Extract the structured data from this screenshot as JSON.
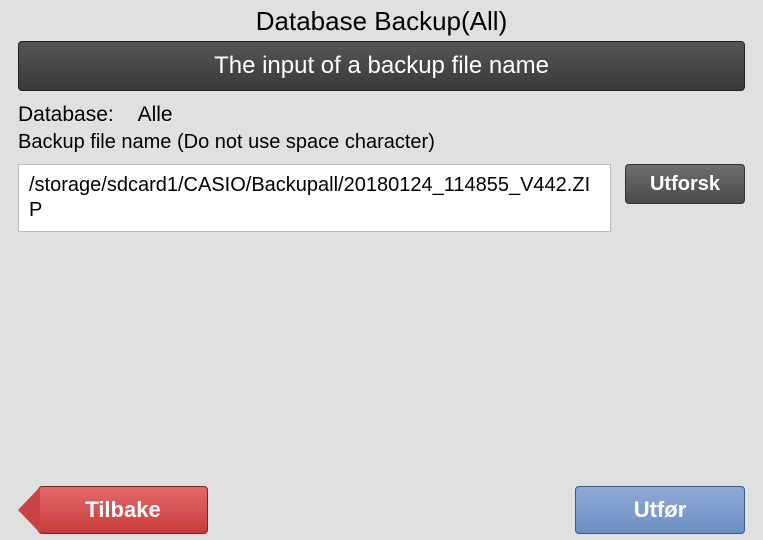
{
  "header": {
    "title": "Database Backup(All)",
    "subtitle": "The input of a backup file name"
  },
  "form": {
    "database_label": "Database:",
    "database_value": "Alle",
    "hint": "Backup file name (Do not use space character)",
    "filename": "/storage/sdcard1/CASIO/Backupall/20180124_114855_V442.ZIP",
    "browse_label": "Utforsk"
  },
  "footer": {
    "back_label": "Tilbake",
    "execute_label": "Utfør"
  }
}
